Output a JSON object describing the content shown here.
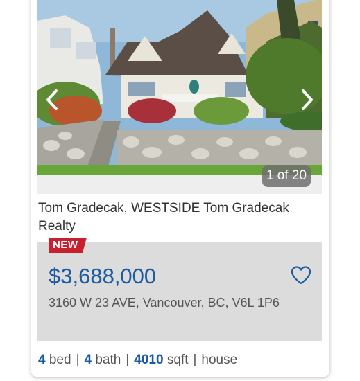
{
  "listing": {
    "photo_counter": "1 of 20",
    "agent": "Tom Gradecak, WESTSIDE Tom Gradecak Realty",
    "badge": "NEW",
    "price": "$3,688,000",
    "address": "3160 W 23 AVE, Vancouver, BC, V6L 1P6",
    "specs": {
      "beds": "4",
      "beds_label": "bed",
      "baths": "4",
      "baths_label": "bath",
      "sqft": "4010",
      "sqft_label": "sqft",
      "type": "house",
      "separator": "|"
    }
  },
  "icons": {
    "prev": "chevron-left-icon",
    "next": "chevron-right-icon",
    "favorite": "heart-outline-icon"
  },
  "colors": {
    "accent": "#1a5aa0",
    "badge": "#c8202f",
    "info_bg": "#dcdcdc"
  }
}
